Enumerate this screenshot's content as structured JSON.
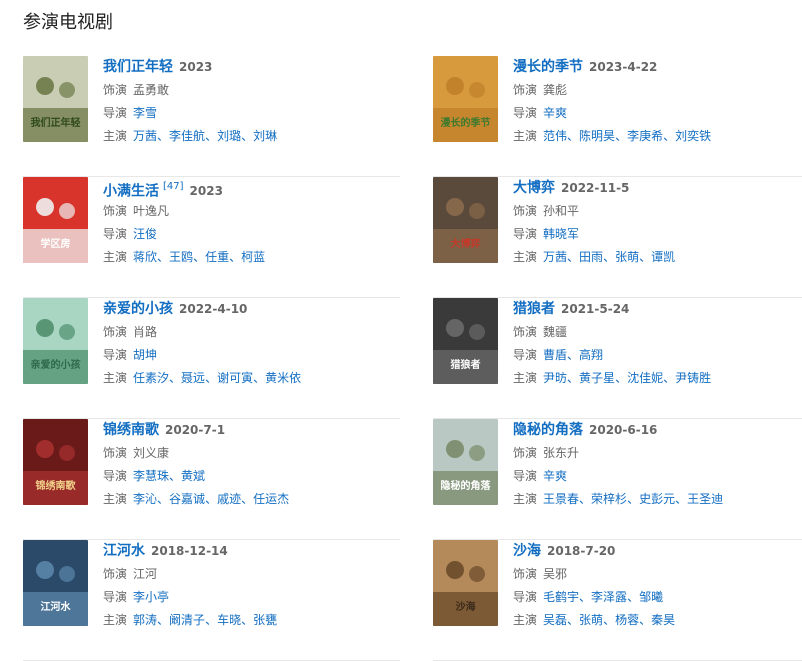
{
  "section_title": "参演电视剧",
  "labels": {
    "role": "饰演",
    "director": "导演",
    "cast": "主演"
  },
  "shows": [
    {
      "title": "我们正年轻",
      "date": "2023",
      "cite": "",
      "role": "孟勇敢",
      "directors": [
        "李雪"
      ],
      "cast": [
        "万茜",
        "李佳航",
        "刘璐",
        "刘琳"
      ],
      "poster_text": "我们正年轻",
      "poster_bg": "#c9cdb3",
      "poster_accent": "#6e7a48",
      "poster_ink": "#2f4a1c"
    },
    {
      "title": "漫长的季节",
      "date": "2023-4-22",
      "cite": "",
      "role": "龚彪",
      "directors": [
        "辛爽"
      ],
      "cast": [
        "范伟",
        "陈明昊",
        "李庚希",
        "刘奕铁"
      ],
      "poster_text": "漫长的季节",
      "poster_bg": "#d79a3c",
      "poster_accent": "#c07f2a",
      "poster_ink": "#3f7a2e"
    },
    {
      "title": "小满生活",
      "date": "2023",
      "cite": "[47]",
      "role": "叶逸凡",
      "directors": [
        "汪俊"
      ],
      "cast": [
        "蒋欣",
        "王鸥",
        "任重",
        "柯蓝"
      ],
      "poster_text": "学区房",
      "poster_bg": "#d8342c",
      "poster_accent": "#f0f0f0",
      "poster_ink": "#ffffff"
    },
    {
      "title": "大博弈",
      "date": "2022-11-5",
      "cite": "",
      "role": "孙和平",
      "directors": [
        "韩晓军"
      ],
      "cast": [
        "万茜",
        "田雨",
        "张萌",
        "谭凯"
      ],
      "poster_text": "大博弈",
      "poster_bg": "#5a4a3c",
      "poster_accent": "#8a6a4a",
      "poster_ink": "#c23a2a"
    },
    {
      "title": "亲爱的小孩",
      "date": "2022-4-10",
      "cite": "",
      "role": "肖路",
      "directors": [
        "胡坤"
      ],
      "cast": [
        "任素汐",
        "聂远",
        "谢可寅",
        "黄米依"
      ],
      "poster_text": "亲爱的小孩",
      "poster_bg": "#a9d6c3",
      "poster_accent": "#4f8f6d",
      "poster_ink": "#2e6a4a"
    },
    {
      "title": "猎狼者",
      "date": "2021-5-24",
      "cite": "",
      "role": "魏疆",
      "directors": [
        "曹盾",
        "高翔"
      ],
      "cast": [
        "尹昉",
        "黄子星",
        "沈佳妮",
        "尹铸胜"
      ],
      "poster_text": "猎狼者",
      "poster_bg": "#3a3a3a",
      "poster_accent": "#6a6a6a",
      "poster_ink": "#ffffff"
    },
    {
      "title": "锦绣南歌",
      "date": "2020-7-1",
      "cite": "",
      "role": "刘义康",
      "directors": [
        "李慧珠",
        "黄斌"
      ],
      "cast": [
        "李沁",
        "谷嘉诚",
        "戚迹",
        "任运杰"
      ],
      "poster_text": "锦绣南歌",
      "poster_bg": "#6b1a1a",
      "poster_accent": "#a83030",
      "poster_ink": "#f2d28a"
    },
    {
      "title": "隐秘的角落",
      "date": "2020-6-16",
      "cite": "",
      "role": "张东升",
      "directors": [
        "辛爽"
      ],
      "cast": [
        "王景春",
        "荣梓杉",
        "史彭元",
        "王圣迪"
      ],
      "poster_text": "隐秘的角落",
      "poster_bg": "#b9c8c2",
      "poster_accent": "#7a8a6a",
      "poster_ink": "#ffffff"
    },
    {
      "title": "江河水",
      "date": "2018-12-14",
      "cite": "",
      "role": "江河",
      "directors": [
        "李小亭"
      ],
      "cast": [
        "郭涛",
        "阚清子",
        "车晓",
        "张甕"
      ],
      "poster_text": "江河水",
      "poster_bg": "#2b4a6a",
      "poster_accent": "#5a86aa",
      "poster_ink": "#ffffff"
    },
    {
      "title": "沙海",
      "date": "2018-7-20",
      "cite": "",
      "role": "吴邪",
      "directors": [
        "毛鹤宇",
        "李泽露",
        "邹曦"
      ],
      "cast": [
        "吴磊",
        "张萌",
        "杨蓉",
        "秦昊"
      ],
      "poster_text": "沙海",
      "poster_bg": "#b48a5a",
      "poster_accent": "#6a4a2a",
      "poster_ink": "#3a2a1a"
    }
  ]
}
